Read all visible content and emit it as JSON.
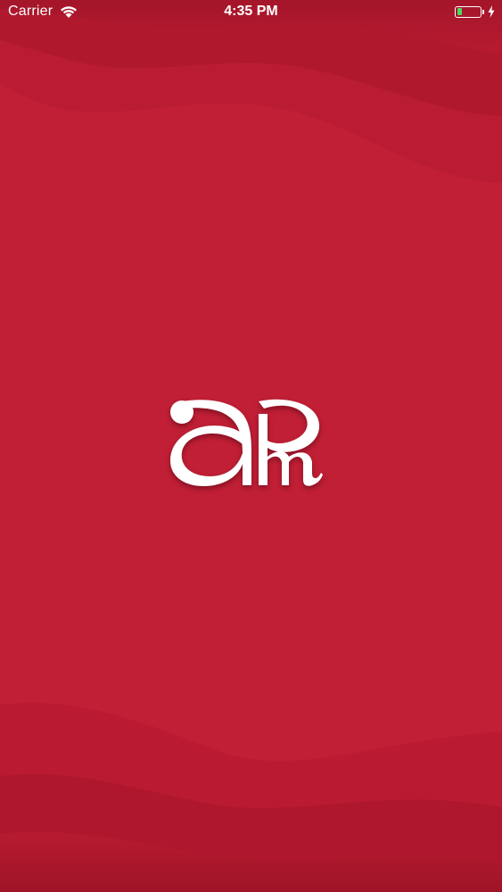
{
  "status_bar": {
    "carrier": "Carrier",
    "time": "4:35 PM",
    "battery_level": 0.22,
    "wifi_icon": "wifi-icon",
    "battery_icon": "battery-icon",
    "charging_icon": "charging-bolt-icon"
  },
  "splash": {
    "logo_icon": "apm-monogram-logo",
    "logo_letters": "apm"
  },
  "colors": {
    "background": "#c01f35",
    "wave_dark": "#a8162a",
    "logo": "#ffffff",
    "battery_fill": "#4cd964"
  }
}
